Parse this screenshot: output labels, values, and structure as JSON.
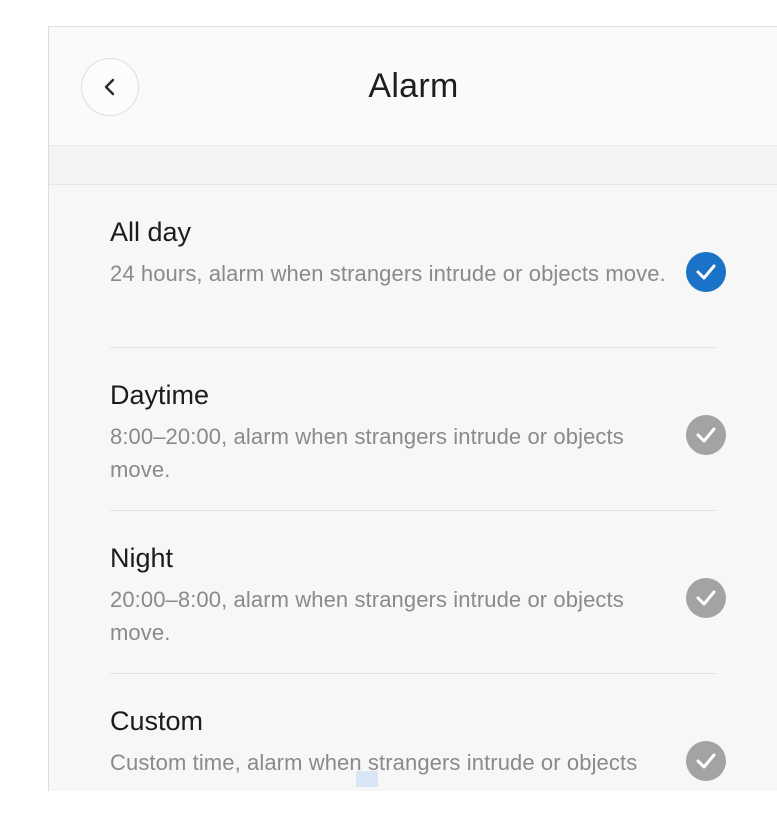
{
  "header": {
    "title": "Alarm",
    "back_icon": "chevron-left-icon"
  },
  "colors": {
    "selected": "#1a72c9",
    "unselected": "#a3a3a3",
    "title_text": "#1e1e1e",
    "description_text": "#8a8a8a"
  },
  "options": [
    {
      "title": "All day",
      "description": "24 hours, alarm when strangers intrude or objects move.",
      "selected": true,
      "icon": "check-circle-icon"
    },
    {
      "title": "Daytime",
      "description": "8:00–20:00, alarm when strangers intrude or objects move.",
      "selected": false,
      "icon": "check-circle-icon"
    },
    {
      "title": "Night",
      "description": "20:00–8:00, alarm when strangers intrude or objects move.",
      "selected": false,
      "icon": "check-circle-icon"
    },
    {
      "title": "Custom",
      "description": "Custom time, alarm when strangers intrude or objects move.",
      "selected": false,
      "icon": "check-circle-icon"
    }
  ]
}
